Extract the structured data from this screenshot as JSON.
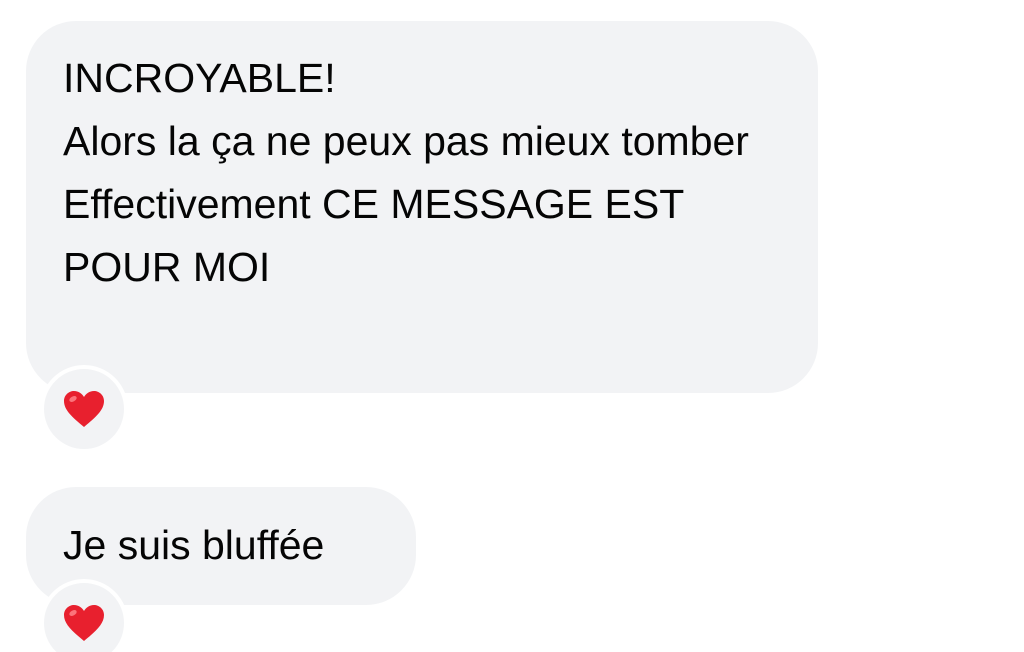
{
  "messages": [
    {
      "lines": [
        "INCROYABLE!",
        "Alors la ça ne peux pas mieux tomber",
        "Effectivement CE MESSAGE EST POUR MOI"
      ],
      "reaction": "heart-icon"
    },
    {
      "lines": [
        "Je suis bluffée"
      ],
      "reaction": "heart-icon"
    }
  ],
  "colors": {
    "bubble_background": "#f2f3f5",
    "text": "#050505",
    "heart": "#e8202e",
    "page_background": "#ffffff"
  }
}
